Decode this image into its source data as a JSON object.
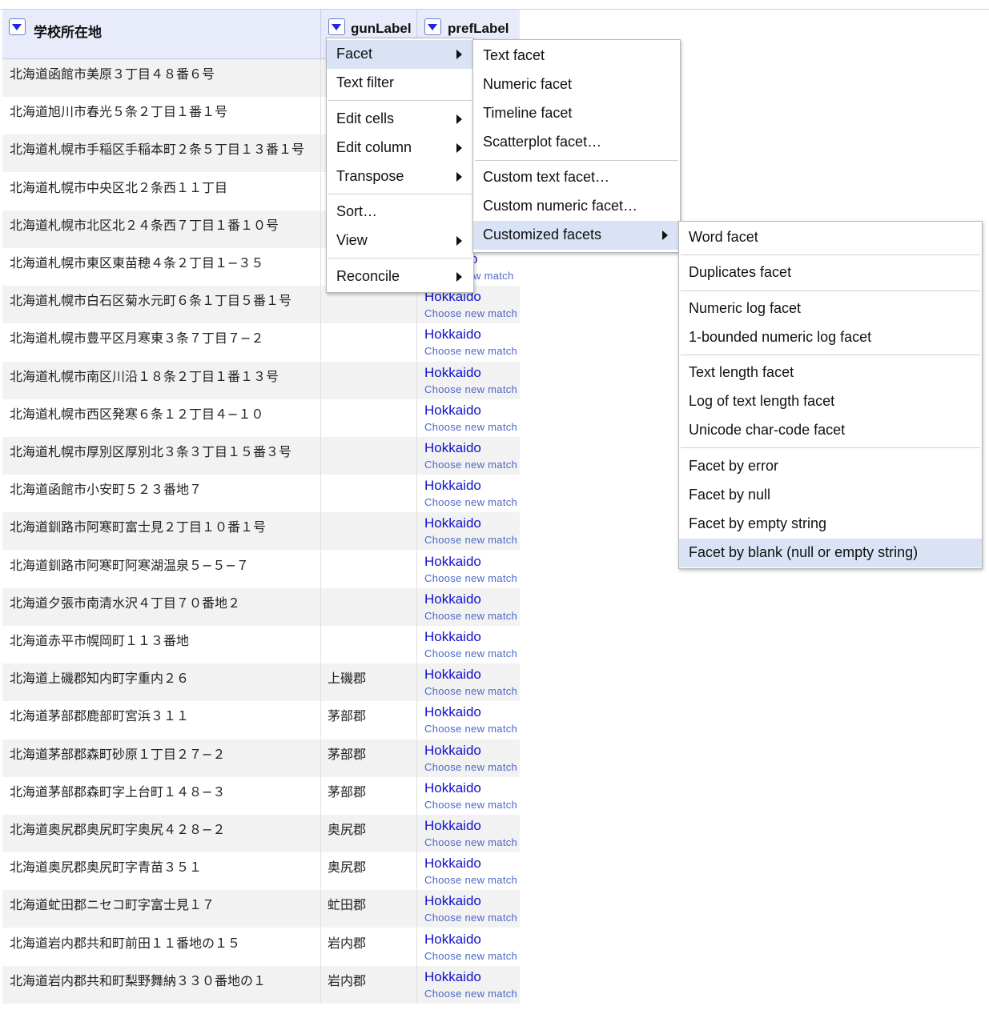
{
  "columns": {
    "col1": "学校所在地",
    "col2": "gunLabel",
    "col3": "prefLabel"
  },
  "rows": [
    {
      "addr": "北海道函館市美原３丁目４８番６号",
      "gun": "",
      "pref": "",
      "choose": ""
    },
    {
      "addr": "北海道旭川市春光５条２丁目１番１号",
      "gun": "",
      "pref": "",
      "choose": ""
    },
    {
      "addr": "北海道札幌市手稲区手稲本町２条５丁目１３番１号",
      "gun": "",
      "pref": "",
      "choose": ""
    },
    {
      "addr": "北海道札幌市中央区北２条西１１丁目",
      "gun": "",
      "pref": "",
      "choose": ""
    },
    {
      "addr": "北海道札幌市北区北２４条西７丁目１番１０号",
      "gun": "",
      "pref": "",
      "choose": ""
    },
    {
      "addr": "北海道札幌市東区東苗穂４条２丁目１−３５",
      "gun": "",
      "pref": "o",
      "choose": "w match"
    },
    {
      "addr": "北海道札幌市白石区菊水元町６条１丁目５番１号",
      "gun": "",
      "pref": "Hokkaido",
      "choose": "Choose new match"
    },
    {
      "addr": "北海道札幌市豊平区月寒東３条７丁目７−２",
      "gun": "",
      "pref": "Hokkaido",
      "choose": "Choose new match"
    },
    {
      "addr": "北海道札幌市南区川沿１８条２丁目１番１３号",
      "gun": "",
      "pref": "Hokkaido",
      "choose": "Choose new match"
    },
    {
      "addr": "北海道札幌市西区発寒６条１２丁目４−１０",
      "gun": "",
      "pref": "Hokkaido",
      "choose": "Choose new match"
    },
    {
      "addr": "北海道札幌市厚別区厚別北３条３丁目１５番３号",
      "gun": "",
      "pref": "Hokkaido",
      "choose": "Choose new match"
    },
    {
      "addr": "北海道函館市小安町５２３番地７",
      "gun": "",
      "pref": "Hokkaido",
      "choose": "Choose new match"
    },
    {
      "addr": "北海道釧路市阿寒町富士見２丁目１０番１号",
      "gun": "",
      "pref": "Hokkaido",
      "choose": "Choose new match"
    },
    {
      "addr": "北海道釧路市阿寒町阿寒湖温泉５−５−７",
      "gun": "",
      "pref": "Hokkaido",
      "choose": "Choose new match"
    },
    {
      "addr": "北海道夕張市南清水沢４丁目７０番地２",
      "gun": "",
      "pref": "Hokkaido",
      "choose": "Choose new match"
    },
    {
      "addr": "北海道赤平市幌岡町１１３番地",
      "gun": "",
      "pref": "Hokkaido",
      "choose": "Choose new match"
    },
    {
      "addr": "北海道上磯郡知内町字重内２６",
      "gun": "上磯郡",
      "pref": "Hokkaido",
      "choose": "Choose new match"
    },
    {
      "addr": "北海道茅部郡鹿部町宮浜３１１",
      "gun": "茅部郡",
      "pref": "Hokkaido",
      "choose": "Choose new match"
    },
    {
      "addr": "北海道茅部郡森町砂原１丁目２７−２",
      "gun": "茅部郡",
      "pref": "Hokkaido",
      "choose": "Choose new match"
    },
    {
      "addr": "北海道茅部郡森町字上台町１４８−３",
      "gun": "茅部郡",
      "pref": "Hokkaido",
      "choose": "Choose new match"
    },
    {
      "addr": "北海道奥尻郡奥尻町字奥尻４２８−２",
      "gun": "奥尻郡",
      "pref": "Hokkaido",
      "choose": "Choose new match"
    },
    {
      "addr": "北海道奥尻郡奥尻町字青苗３５１",
      "gun": "奥尻郡",
      "pref": "Hokkaido",
      "choose": "Choose new match"
    },
    {
      "addr": "北海道虻田郡ニセコ町字富士見１７",
      "gun": "虻田郡",
      "pref": "Hokkaido",
      "choose": "Choose new match"
    },
    {
      "addr": "北海道岩内郡共和町前田１１番地の１５",
      "gun": "岩内郡",
      "pref": "Hokkaido",
      "choose": "Choose new match"
    },
    {
      "addr": "北海道岩内郡共和町梨野舞納３３０番地の１",
      "gun": "岩内郡",
      "pref": "Hokkaido",
      "choose": "Choose new match"
    }
  ],
  "menu1": {
    "facet": "Facet",
    "text_filter": "Text filter",
    "edit_cells": "Edit cells",
    "edit_column": "Edit column",
    "transpose": "Transpose",
    "sort": "Sort…",
    "view": "View",
    "reconcile": "Reconcile"
  },
  "menu2": {
    "text_facet": "Text facet",
    "numeric_facet": "Numeric facet",
    "timeline_facet": "Timeline facet",
    "scatterplot_facet": "Scatterplot facet…",
    "custom_text_facet": "Custom text facet…",
    "custom_numeric_facet": "Custom numeric facet…",
    "customized_facets": "Customized facets"
  },
  "menu3": {
    "word_facet": "Word facet",
    "duplicates_facet": "Duplicates facet",
    "numeric_log_facet": "Numeric log facet",
    "bounded_log_facet": "1-bounded numeric log facet",
    "text_length_facet": "Text length facet",
    "log_text_length_facet": "Log of text length facet",
    "unicode_facet": "Unicode char-code facet",
    "facet_error": "Facet by error",
    "facet_null": "Facet by null",
    "facet_empty": "Facet by empty string",
    "facet_blank": "Facet by blank (null or empty string)"
  },
  "colors": {
    "link": "#1111cc",
    "choose": "#4a68c9",
    "header_bg": "#e8ebfa",
    "highlight": "#d9e3f5"
  }
}
